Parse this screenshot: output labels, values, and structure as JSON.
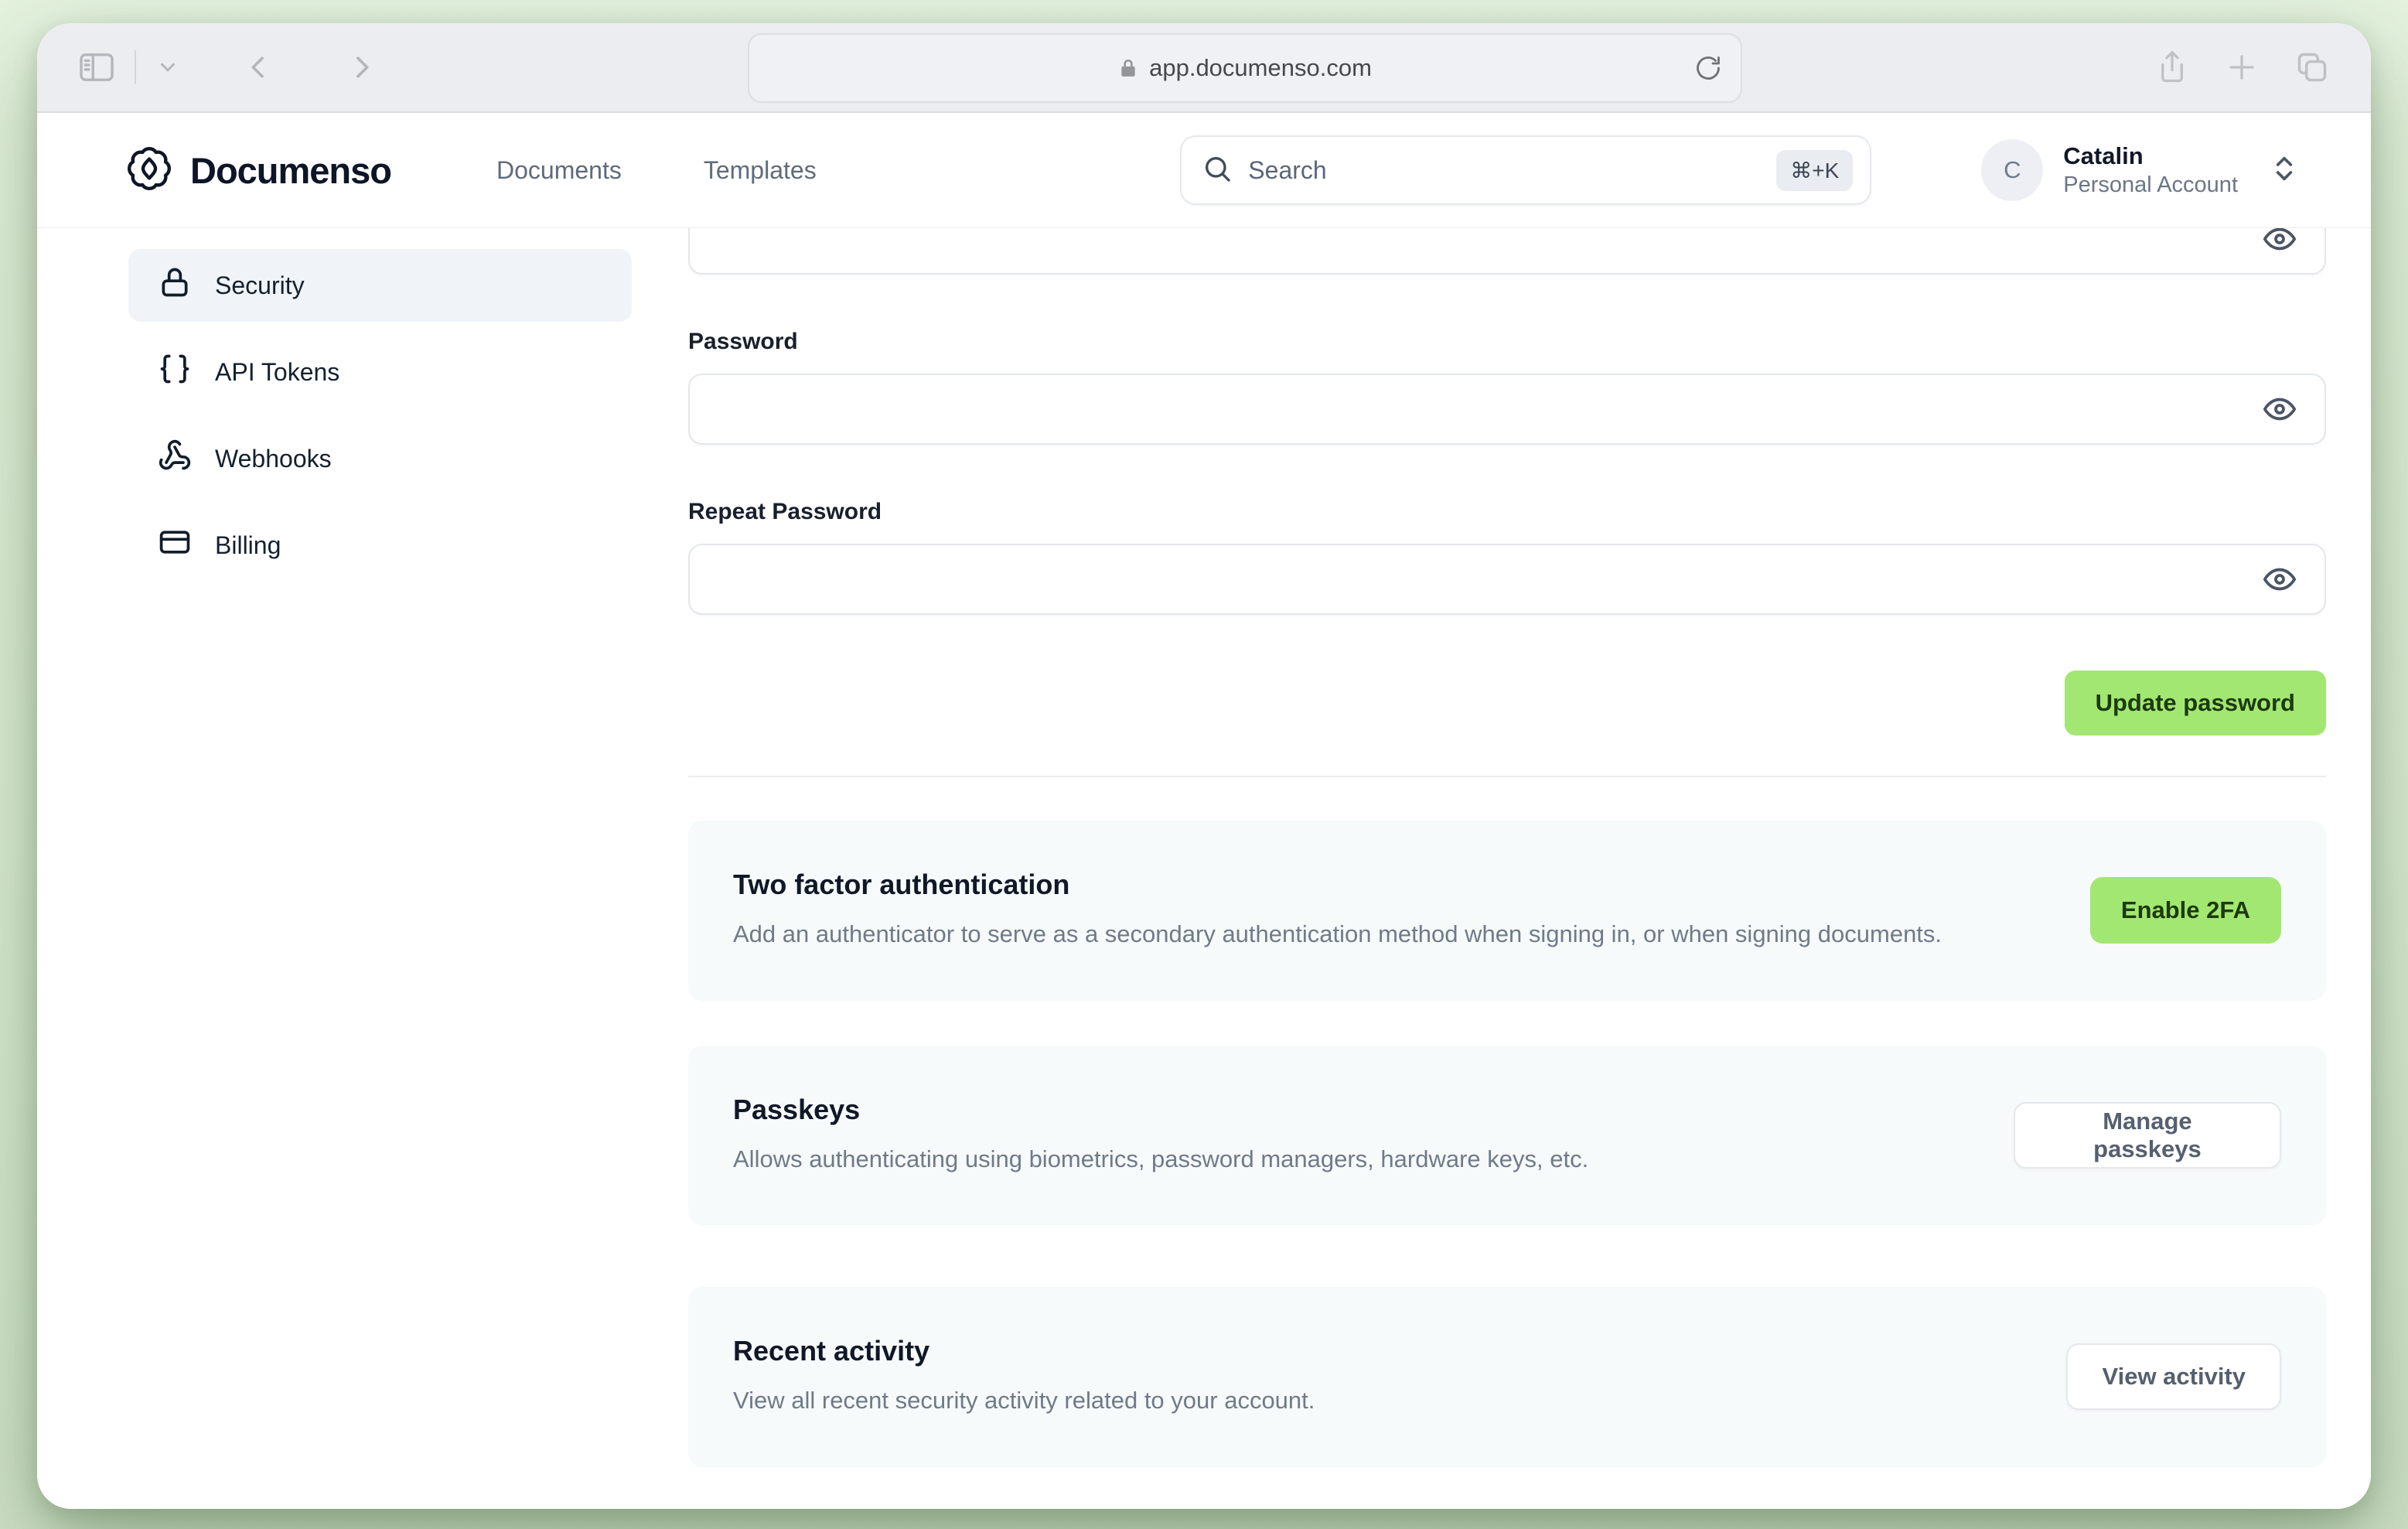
{
  "browser": {
    "url": "app.documenso.com"
  },
  "header": {
    "brand": "Documenso",
    "nav": {
      "documents": "Documents",
      "templates": "Templates"
    },
    "search": {
      "placeholder": "Search",
      "shortcut": "⌘+K"
    },
    "user": {
      "initial": "C",
      "name": "Catalin",
      "account_type": "Personal Account"
    }
  },
  "sidebar": {
    "items": [
      {
        "label": "Security",
        "icon": "lock",
        "active": true
      },
      {
        "label": "API Tokens",
        "icon": "braces",
        "active": false
      },
      {
        "label": "Webhooks",
        "icon": "webhook",
        "active": false
      },
      {
        "label": "Billing",
        "icon": "credit-card",
        "active": false
      }
    ]
  },
  "password_form": {
    "password_label": "Password",
    "repeat_password_label": "Repeat Password",
    "password_value": "",
    "repeat_password_value": "",
    "submit_label": "Update password"
  },
  "sections": [
    {
      "title": "Two factor authentication",
      "description": "Add an authenticator to serve as a secondary authentication method when signing in, or when signing documents.",
      "button_label": "Enable 2FA",
      "button_style": "primary"
    },
    {
      "title": "Passkeys",
      "description": "Allows authenticating using biometrics, password managers, hardware keys, etc.",
      "button_label": "Manage passkeys",
      "button_style": "outline"
    },
    {
      "title": "Recent activity",
      "description": "View all recent security activity related to your account.",
      "button_label": "View activity",
      "button_style": "outline"
    }
  ],
  "colors": {
    "brand_green": "#a2e771",
    "brand_green_text": "#1c3a0e",
    "desktop_background": "#daecd3",
    "card_background": "#f7fafa",
    "sidebar_active_background": "#f0f3f7",
    "ink": "#101828",
    "muted_text": "#6f7a89"
  }
}
